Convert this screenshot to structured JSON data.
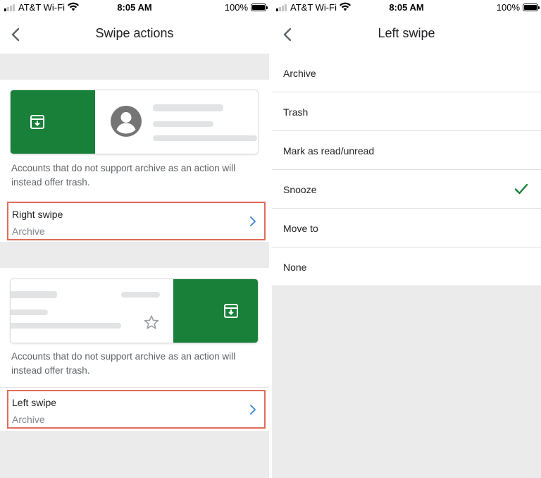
{
  "status_left": {
    "carrier": "AT&T Wi-Fi",
    "time": "8:05 AM",
    "battery": "100%"
  },
  "status_right": {
    "carrier": "AT&T Wi-Fi",
    "time": "8:05 AM",
    "battery": "100%"
  },
  "left_screen": {
    "title": "Swipe actions",
    "right_swipe_preview": {
      "action_icon": "archive-icon",
      "action_color": "#188038"
    },
    "right_swipe_note": "Accounts that do not support archive as an action will instead offer trash.",
    "right_swipe_row": {
      "label": "Right swipe",
      "value": "Archive"
    },
    "left_swipe_preview": {
      "action_icon": "archive-icon",
      "action_color": "#188038"
    },
    "left_swipe_note": "Accounts that do not support archive as an action will instead offer trash.",
    "left_swipe_row": {
      "label": "Left swipe",
      "value": "Archive"
    }
  },
  "right_screen": {
    "title": "Left swipe",
    "options": [
      {
        "label": "Archive",
        "selected": false
      },
      {
        "label": "Trash",
        "selected": false
      },
      {
        "label": "Mark as read/unread",
        "selected": false
      },
      {
        "label": "Snooze",
        "selected": true
      },
      {
        "label": "Move to",
        "selected": false
      },
      {
        "label": "None",
        "selected": false
      }
    ],
    "check_color": "#188038"
  },
  "colors": {
    "highlight_border": "#e06c5b",
    "chevron": "#4a90d9",
    "back_arrow": "#5f6368"
  }
}
